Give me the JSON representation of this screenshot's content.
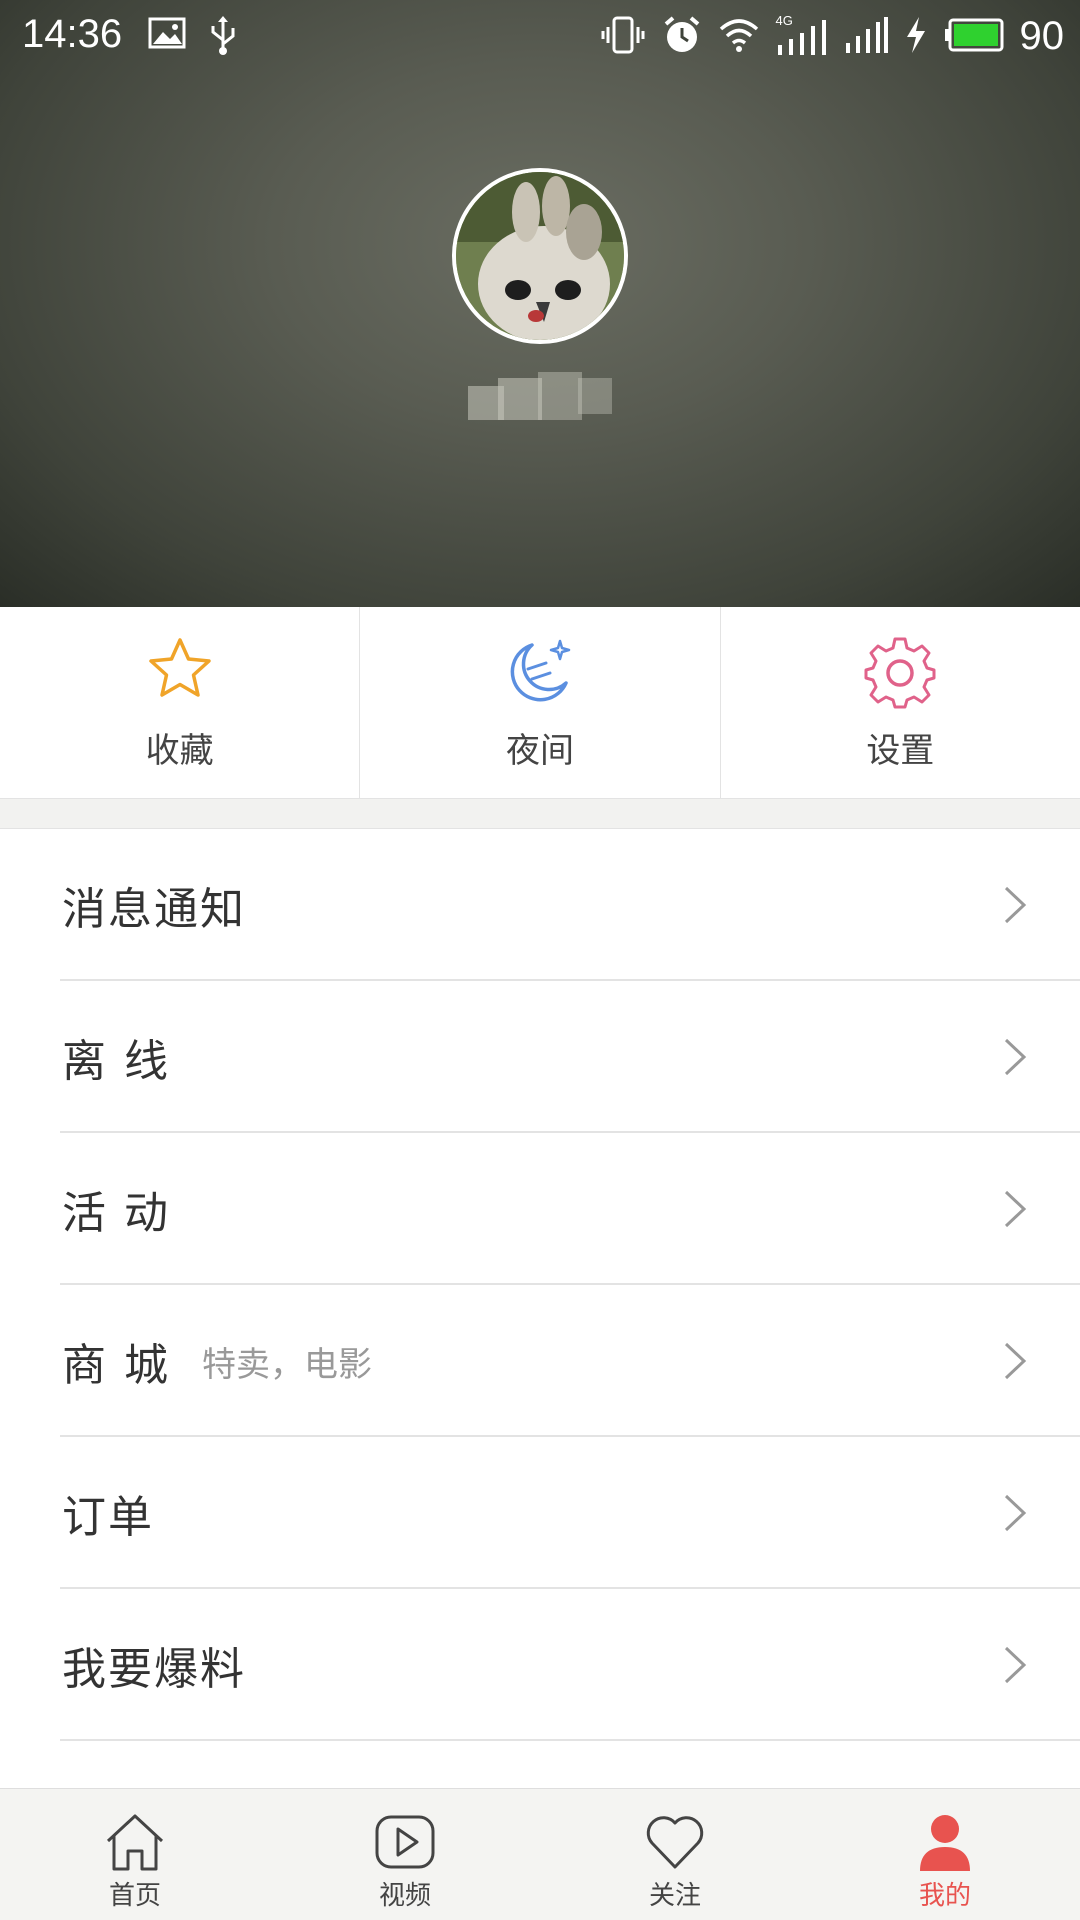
{
  "status_bar": {
    "time": "14:36",
    "network": "4G",
    "battery": "90",
    "icons": [
      "image-icon",
      "usb-icon",
      "vibrate-icon",
      "alarm-icon",
      "wifi-icon",
      "signal-icon",
      "signal-icon",
      "charging-icon",
      "battery-icon"
    ]
  },
  "profile": {
    "avatar_icon": "avatar-photo",
    "username": ""
  },
  "quick_actions": [
    {
      "label": "收藏",
      "icon": "star-icon",
      "color": "#f0a429"
    },
    {
      "label": "夜间",
      "icon": "moon-icon",
      "color": "#5b8fe0"
    },
    {
      "label": "设置",
      "icon": "gear-icon",
      "color": "#e0628a"
    }
  ],
  "menu": [
    {
      "label": "消息通知",
      "sub": ""
    },
    {
      "label": "离 线",
      "sub": ""
    },
    {
      "label": "活 动",
      "sub": ""
    },
    {
      "label": "商 城",
      "sub": "特卖，电影"
    },
    {
      "label": "订单",
      "sub": ""
    },
    {
      "label": "我要爆料",
      "sub": ""
    }
  ],
  "bottom_nav": [
    {
      "label": "首页",
      "icon": "home-icon",
      "active": false
    },
    {
      "label": "视频",
      "icon": "video-icon",
      "active": false
    },
    {
      "label": "关注",
      "icon": "heart-icon",
      "active": false
    },
    {
      "label": "我的",
      "icon": "profile-icon",
      "active": true
    }
  ],
  "colors": {
    "accent": "#e8534f",
    "header_bg": "#595c52"
  }
}
